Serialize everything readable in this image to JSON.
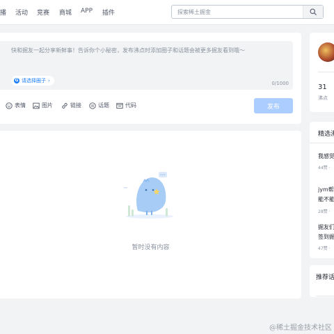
{
  "nav": {
    "items": [
      "播",
      "活动",
      "竞赛",
      "商城",
      "APP",
      "插件"
    ],
    "search_placeholder": "探索稀土掘金"
  },
  "composer": {
    "placeholder": "快和掘友一起分享新鲜事！告诉你个小秘密，发布沸点时添加圈子和话题会被更多掘友看到哦～",
    "circle_label": "请选择圈子",
    "char_count": "0/1000",
    "tools": [
      "表情",
      "图片",
      "链接",
      "话题",
      "代码"
    ],
    "publish_label": "发布"
  },
  "feed": {
    "empty_text": "暂时没有内容"
  },
  "profile": {
    "stat_value": "31",
    "stat_label": "沸点"
  },
  "selected": {
    "title": "精选沸",
    "items": [
      {
        "text": "我感觉",
        "meta": "44赞 ·"
      },
      {
        "text": "jym帮",
        "text2": "能不能",
        "meta": "28赞 ·"
      },
      {
        "text": "掘友们",
        "text2": "签到掘",
        "meta": "47赞 ·"
      }
    ]
  },
  "recommend": {
    "title": "推荐话"
  },
  "watermark": "@稀土掘金技术社区",
  "colors": {
    "accent": "#1e80ff",
    "publish_disabled": "#abcdff",
    "page_bg": "#f2f3f5"
  }
}
